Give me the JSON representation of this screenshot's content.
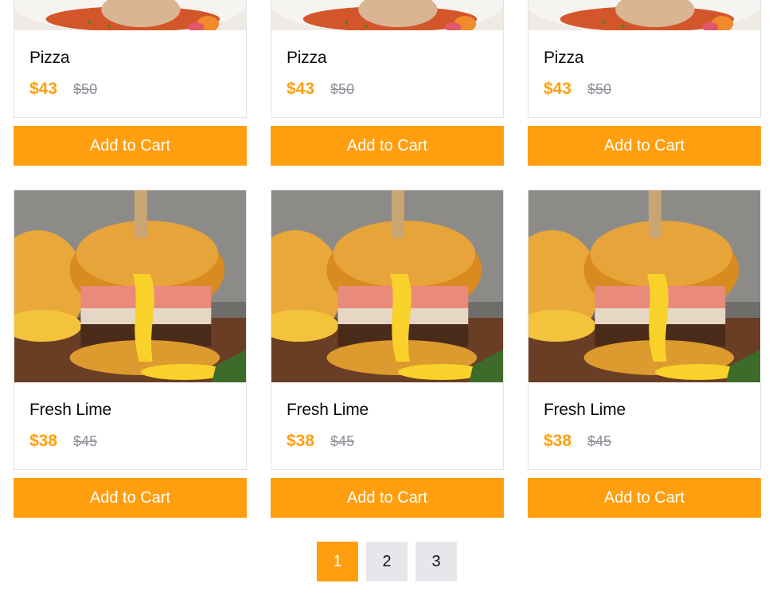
{
  "products": [
    {
      "name": "Pizza",
      "price": "$43",
      "old_price": "$50",
      "button": "Add to Cart",
      "image": "pizza-image"
    },
    {
      "name": "Pizza",
      "price": "$43",
      "old_price": "$50",
      "button": "Add to Cart",
      "image": "pizza-image"
    },
    {
      "name": "Pizza",
      "price": "$43",
      "old_price": "$50",
      "button": "Add to Cart",
      "image": "pizza-image"
    },
    {
      "name": "Fresh Lime",
      "price": "$38",
      "old_price": "$45",
      "button": "Add to Cart",
      "image": "burger-image"
    },
    {
      "name": "Fresh Lime",
      "price": "$38",
      "old_price": "$45",
      "button": "Add to Cart",
      "image": "burger-image"
    },
    {
      "name": "Fresh Lime",
      "price": "$38",
      "old_price": "$45",
      "button": "Add to Cart",
      "image": "burger-image"
    }
  ],
  "pagination": {
    "pages": [
      "1",
      "2",
      "3"
    ],
    "active": "1"
  },
  "colors": {
    "accent": "#ff9f0f",
    "old_price": "#8a8f98",
    "page_inactive": "#e6e7eb"
  }
}
